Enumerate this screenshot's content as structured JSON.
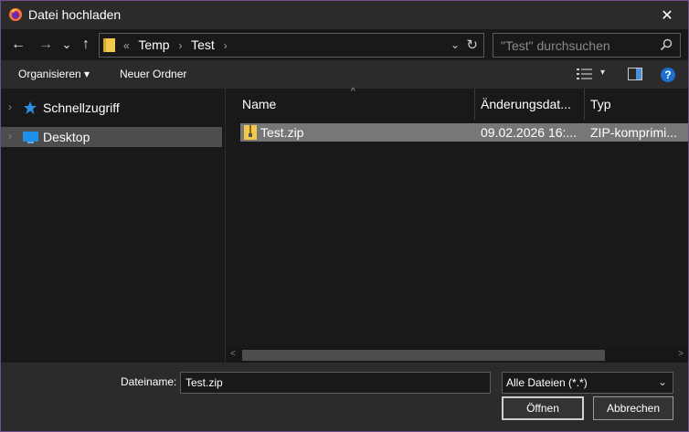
{
  "window": {
    "title": "Datei hochladen",
    "close_glyph": "✕",
    "border_color": "#6e4f8a"
  },
  "nav": {
    "back_glyph": "←",
    "forward_glyph": "→",
    "recent_glyph": "⌄",
    "up_glyph": "↑",
    "address": {
      "prefix": "«",
      "crumbs": [
        "Temp",
        "Test"
      ],
      "separator": "›",
      "dropdown_glyph": "⌄",
      "refresh_glyph": "↻"
    },
    "search": {
      "placeholder": "\"Test\" durchsuchen",
      "value": ""
    }
  },
  "toolbar": {
    "organize_label": "Organisieren ▾",
    "new_folder_label": "Neuer Ordner",
    "view_dropdown_glyph": "▾",
    "help_glyph": "?"
  },
  "sidebar": {
    "items": [
      {
        "label": "Schnellzugriff",
        "icon": "star-pin-icon",
        "chevron": "›",
        "selected": false
      },
      {
        "label": "Desktop",
        "icon": "desktop-icon",
        "chevron": "›",
        "selected": true
      }
    ]
  },
  "filelist": {
    "sort_glyph": "^",
    "columns": [
      {
        "label": "Name"
      },
      {
        "label": "Änderungsdat..."
      },
      {
        "label": "Typ"
      }
    ],
    "rows": [
      {
        "name": "Test.zip",
        "modified": "09.02.2026 16:...",
        "type": "ZIP-komprimi...",
        "icon": "zip-folder-icon",
        "selected": true
      }
    ]
  },
  "scrollbar": {
    "left_glyph": "<",
    "right_glyph": ">"
  },
  "bottom": {
    "filename_label": "Dateiname:",
    "filename_value": "Test.zip",
    "filetype_value": "Alle Dateien (*.*)",
    "filetype_dropdown_glyph": "⌄",
    "open_label": "Öffnen",
    "cancel_label": "Abbrechen"
  },
  "colors": {
    "accent": "#1e6fd0",
    "selection": "#777777",
    "folder": "#f2c94c"
  }
}
